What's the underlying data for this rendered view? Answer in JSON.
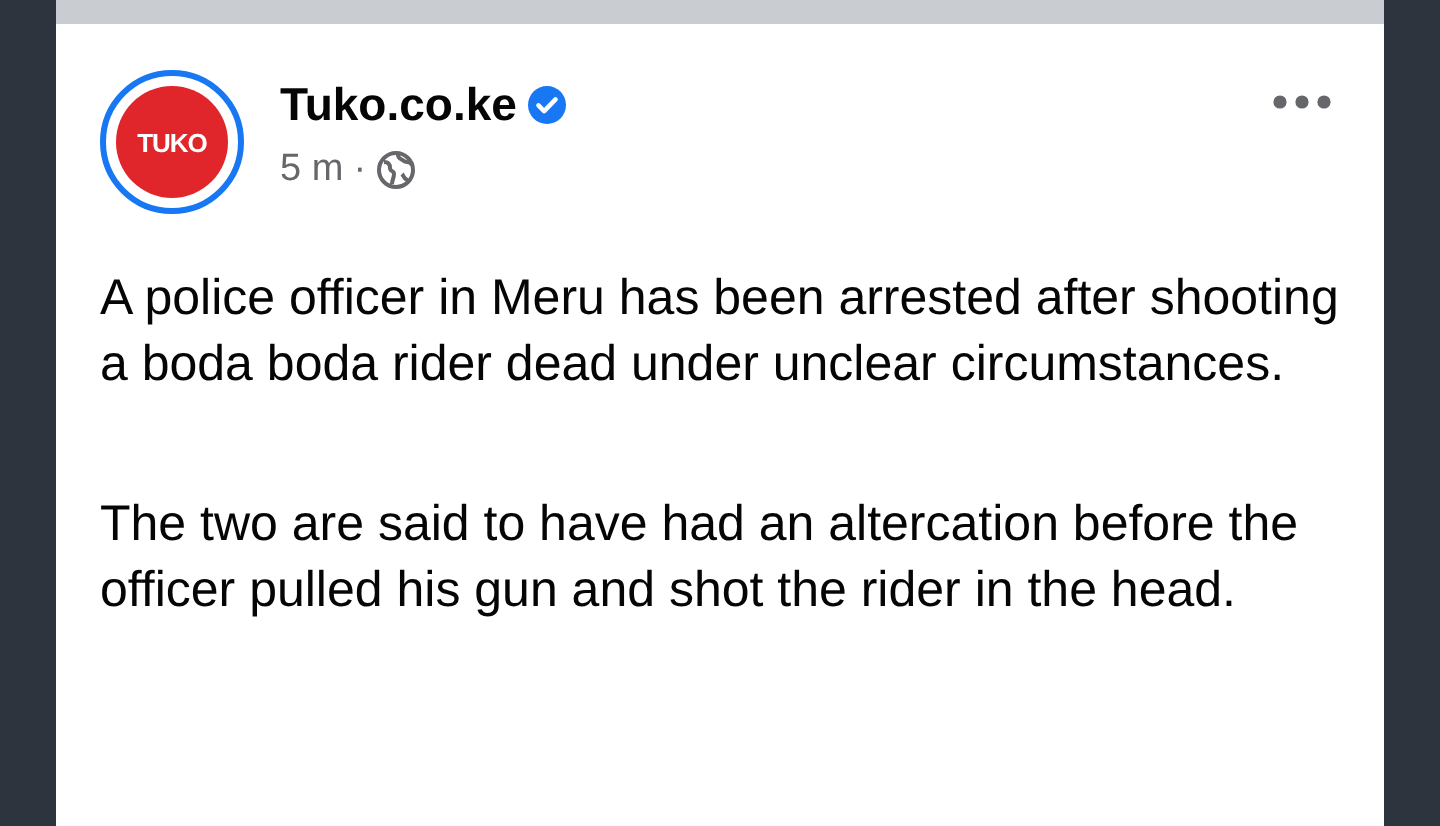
{
  "post": {
    "author": "Tuko.co.ke",
    "avatar_text": "TUKO",
    "verified": true,
    "time": "5 m",
    "separator": "·",
    "paragraphs": [
      "A police officer in Meru has been arrested after shooting a boda boda rider dead under unclear circumstances.",
      "The two are said to have had an altercation before the officer pulled his gun and shot the rider in the head."
    ]
  }
}
